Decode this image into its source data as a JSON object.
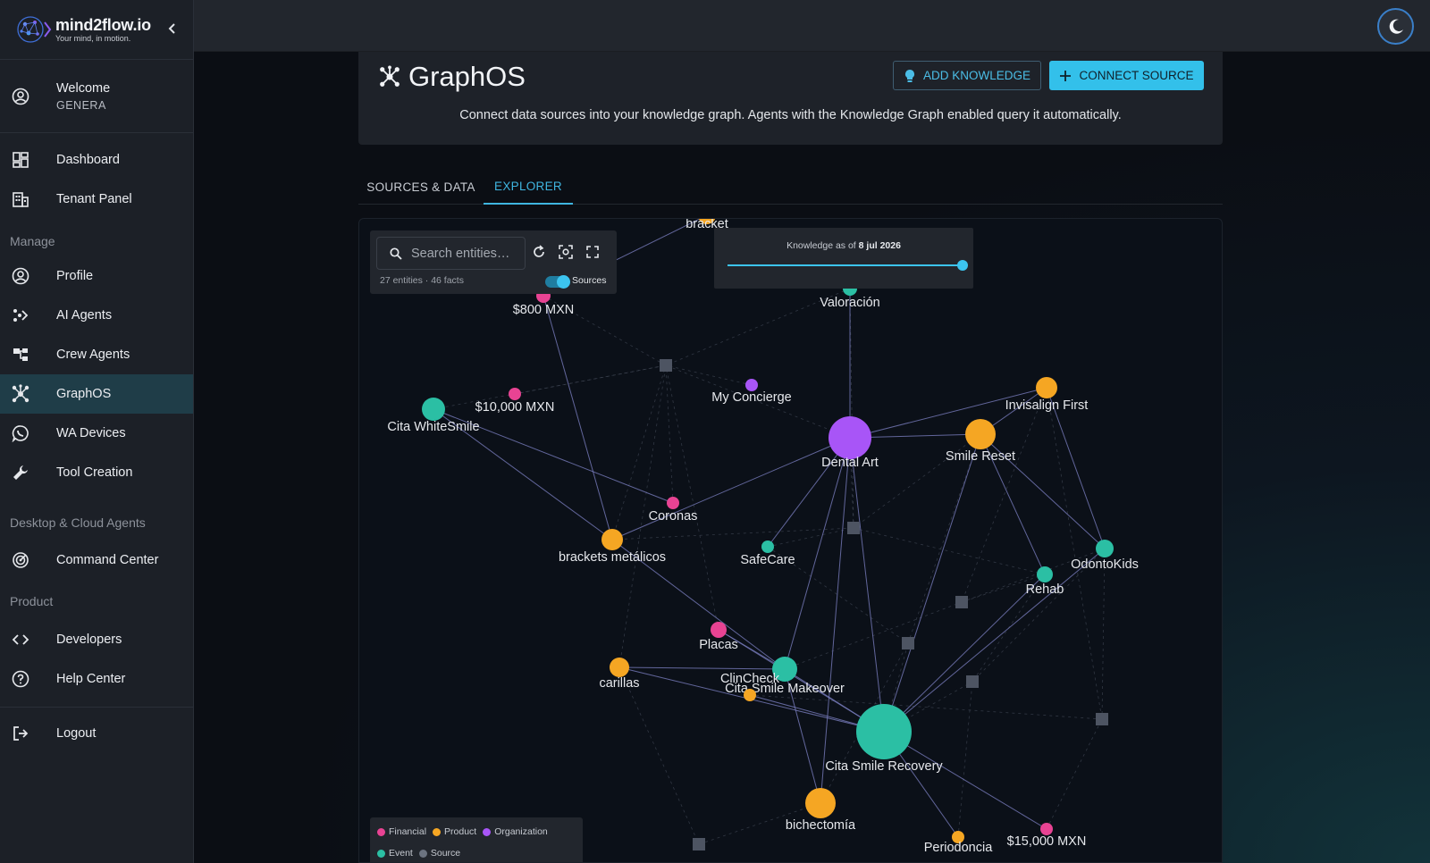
{
  "brand": {
    "name": "mind2flow.io",
    "tagline": "Your mind, in motion."
  },
  "sidebar": {
    "welcome": {
      "title": "Welcome",
      "user": "GENERA"
    },
    "top_items": [
      {
        "label": "Dashboard",
        "icon": "dashboard-icon"
      },
      {
        "label": "Tenant Panel",
        "icon": "building-icon"
      }
    ],
    "manage_label": "Manage",
    "manage_items": [
      {
        "label": "Profile",
        "icon": "user-circle-icon"
      },
      {
        "label": "AI Agents",
        "icon": "agents-icon"
      },
      {
        "label": "Crew Agents",
        "icon": "crew-icon"
      },
      {
        "label": "GraphOS",
        "icon": "graph-icon",
        "active": true
      },
      {
        "label": "WA Devices",
        "icon": "whatsapp-icon"
      },
      {
        "label": "Tool Creation",
        "icon": "wrench-icon"
      }
    ],
    "desktop_label": "Desktop & Cloud Agents",
    "desktop_items": [
      {
        "label": "Command Center",
        "icon": "radar-icon"
      }
    ],
    "product_label": "Product",
    "product_items": [
      {
        "label": "Developers",
        "icon": "code-icon"
      },
      {
        "label": "Help Center",
        "icon": "help-icon"
      }
    ],
    "logout": {
      "label": "Logout",
      "icon": "logout-icon"
    }
  },
  "header": {
    "title": "GraphOS",
    "add_knowledge": "ADD KNOWLEDGE",
    "connect_source": "CONNECT SOURCE",
    "subtitle": "Connect data sources into your knowledge graph. Agents with the Knowledge Graph enabled query it automatically."
  },
  "tabs": [
    {
      "label": "SOURCES & DATA",
      "active": false
    },
    {
      "label": "EXPLORER",
      "active": true
    }
  ],
  "explorer": {
    "search_placeholder": "Search entities…",
    "stats": "27 entities · 46 facts",
    "sources_toggle_label": "Sources",
    "sources_toggle_on": true,
    "time_prefix": "Knowledge as of",
    "time_value": "8 jul 2026",
    "time_slider_fraction": 1.0
  },
  "legend": [
    {
      "label": "Financial",
      "color": "#e84393"
    },
    {
      "label": "Product",
      "color": "#f5a623"
    },
    {
      "label": "Organization",
      "color": "#a855f7"
    },
    {
      "label": "Event",
      "color": "#2bbfa4"
    },
    {
      "label": "Source",
      "color": "#6b7380"
    }
  ],
  "graph": {
    "entities": [
      {
        "label": "bracket",
        "type": "Product"
      },
      {
        "label": "$800 MXN",
        "type": "Financial"
      },
      {
        "label": "Valoración",
        "type": "Event"
      },
      {
        "label": "My Concierge",
        "type": "Organization"
      },
      {
        "label": "Invisalign First",
        "type": "Product"
      },
      {
        "label": "Cita WhiteSmile",
        "type": "Event"
      },
      {
        "label": "$10,000 MXN",
        "type": "Financial"
      },
      {
        "label": "Dental Art",
        "type": "Organization"
      },
      {
        "label": "Smile Reset",
        "type": "Product"
      },
      {
        "label": "Coronas",
        "type": "Financial"
      },
      {
        "label": "brackets metálicos",
        "type": "Product"
      },
      {
        "label": "SafeCare",
        "type": "Event"
      },
      {
        "label": "OdontoKids",
        "type": "Event"
      },
      {
        "label": "Rehab",
        "type": "Event"
      },
      {
        "label": "Placas",
        "type": "Financial"
      },
      {
        "label": "carillas",
        "type": "Product"
      },
      {
        "label": "Cita Smile Makeover",
        "type": "Event"
      },
      {
        "label": "ClinCheck",
        "type": "Product"
      },
      {
        "label": "Cita Smile Recovery",
        "type": "Event"
      },
      {
        "label": "bichectomía",
        "type": "Product"
      },
      {
        "label": "$15,000 MXN",
        "type": "Financial"
      },
      {
        "label": "Periodoncia",
        "type": "Product"
      }
    ]
  }
}
